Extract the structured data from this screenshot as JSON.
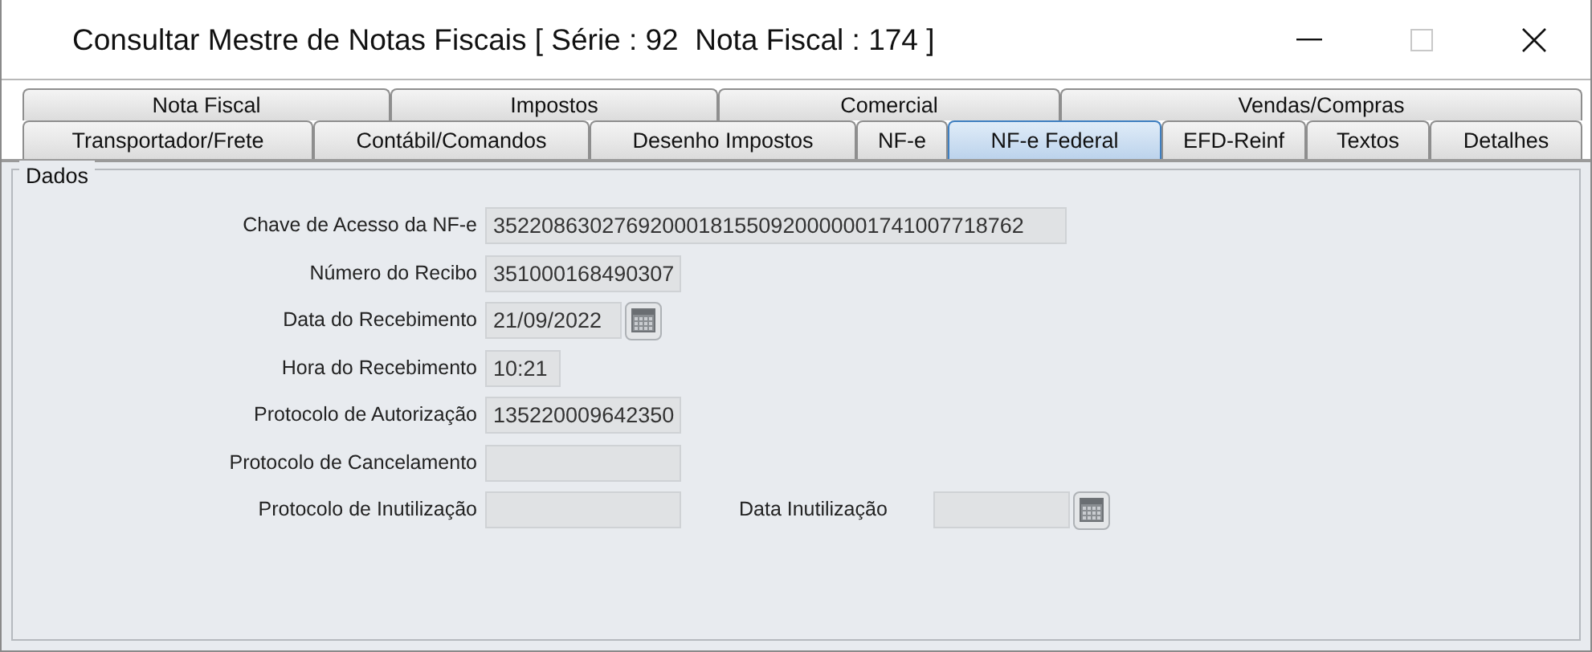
{
  "window": {
    "title": "Consultar Mestre de Notas Fiscais [ Série : 92  Nota Fiscal : 174 ]"
  },
  "tab_rows": [
    [
      {
        "label": "Nota Fiscal",
        "selected": false
      },
      {
        "label": "Impostos",
        "selected": false
      },
      {
        "label": "Comercial",
        "selected": false
      },
      {
        "label": "Vendas/Compras",
        "selected": false
      }
    ],
    [
      {
        "label": "Transportador/Frete",
        "selected": false
      },
      {
        "label": "Contábil/Comandos",
        "selected": false
      },
      {
        "label": "Desenho Impostos",
        "selected": false
      },
      {
        "label": "NF-e",
        "selected": false
      },
      {
        "label": "NF-e Federal",
        "selected": true
      },
      {
        "label": "EFD-Reinf",
        "selected": false
      },
      {
        "label": "Textos",
        "selected": false
      },
      {
        "label": "Detalhes",
        "selected": false
      }
    ]
  ],
  "group": {
    "title": "Dados",
    "rows": [
      {
        "fields": [
          {
            "label": "Chave de Acesso da NF-e",
            "value": "35220863027692000181550920000001741007718762",
            "kind": "key"
          }
        ]
      },
      {
        "fields": [
          {
            "label": "Número do Recibo",
            "value": "351000168490307",
            "kind": "number"
          }
        ]
      },
      {
        "fields": [
          {
            "label": "Data do Recebimento",
            "value": "21/09/2022",
            "kind": "date"
          }
        ]
      },
      {
        "fields": [
          {
            "label": "Hora do Recebimento",
            "value": "10:21",
            "kind": "time"
          }
        ]
      },
      {
        "fields": [
          {
            "label": "Protocolo de Autorização",
            "value": "135220009642350",
            "kind": "number"
          }
        ]
      },
      {
        "fields": [
          {
            "label": "Protocolo de Cancelamento",
            "kind": "number"
          }
        ]
      },
      {
        "fields": [
          {
            "label": "Protocolo de Inutilização",
            "kind": "number"
          },
          {
            "label": "Data Inutilização",
            "kind": "date"
          }
        ]
      }
    ]
  }
}
